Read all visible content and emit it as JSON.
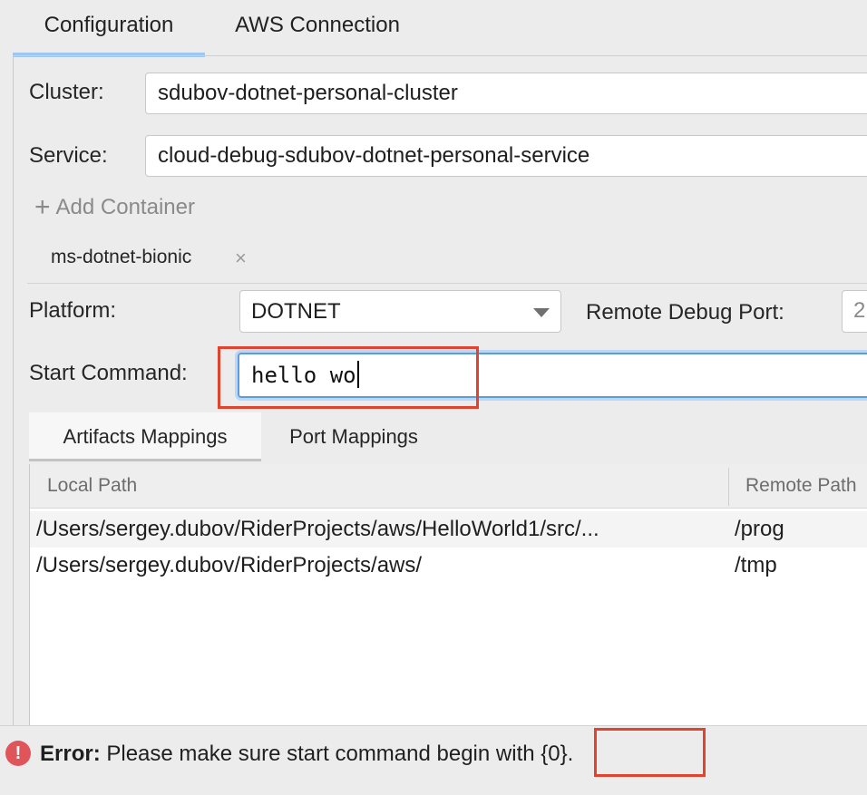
{
  "tabs": [
    {
      "label": "Configuration",
      "active": true
    },
    {
      "label": "AWS Connection",
      "active": false
    }
  ],
  "cluster": {
    "label": "Cluster:",
    "value": "sdubov-dotnet-personal-cluster"
  },
  "service": {
    "label": "Service:",
    "value": "cloud-debug-sdubov-dotnet-personal-service"
  },
  "add_container_label": "Add Container",
  "container_tab": {
    "label": "ms-dotnet-bionic",
    "close_glyph": "×"
  },
  "platform": {
    "label": "Platform:",
    "value": "DOTNET"
  },
  "remote_debug_port": {
    "label": "Remote Debug Port:",
    "value": "2"
  },
  "start_command": {
    "label": "Start Command:",
    "value": "hello wo"
  },
  "sub_tabs": [
    {
      "label": "Artifacts Mappings",
      "active": true
    },
    {
      "label": "Port Mappings",
      "active": false
    }
  ],
  "table": {
    "columns": [
      "Local Path",
      "Remote Path"
    ],
    "rows": [
      [
        "/Users/sergey.dubov/RiderProjects/aws/HelloWorld1/src/...",
        "/prog"
      ],
      [
        "/Users/sergey.dubov/RiderProjects/aws/",
        "/tmp"
      ]
    ]
  },
  "error": {
    "icon": "!",
    "prefix": "Error:",
    "message": "Please make sure start command begin with {0}."
  },
  "colors": {
    "accent": "#5d9be0",
    "annotation": "#e0432e",
    "error": "#e0555a"
  }
}
